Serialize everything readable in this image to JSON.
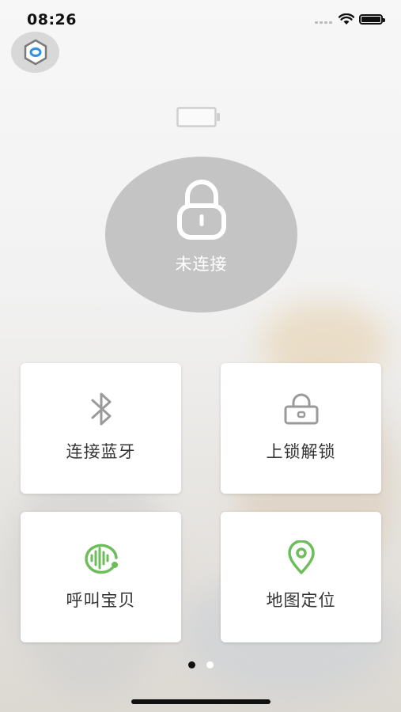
{
  "status_bar": {
    "time": "08:26"
  },
  "device": {
    "status": "未连接"
  },
  "cards": [
    {
      "label": "连接蓝牙",
      "icon": "bluetooth-icon"
    },
    {
      "label": "上锁解锁",
      "icon": "padlock-icon"
    },
    {
      "label": "呼叫宝贝",
      "icon": "voice-call-icon"
    },
    {
      "label": "地图定位",
      "icon": "map-pin-icon"
    }
  ],
  "pager": {
    "current": 1,
    "total": 2
  },
  "colors": {
    "accent_green": "#6dbd5a",
    "icon_gray": "#9a9a9a",
    "lock_circle": "#c4c4c4",
    "settings_blue": "#2f8fe6"
  }
}
